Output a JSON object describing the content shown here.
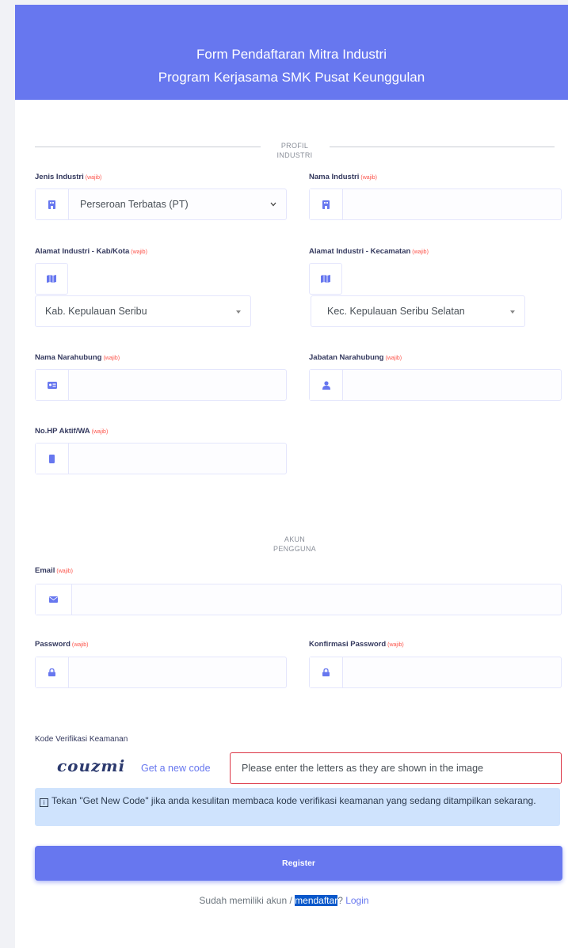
{
  "header": {
    "title_line1": "Form Pendaftaran Mitra Industri",
    "title_line2": "Program Kerjasama SMK Pusat Keunggulan"
  },
  "required_tag": "(wajib)",
  "section_profil": {
    "line1": "PROFIL",
    "line2": "INDUSTRI"
  },
  "section_akun": {
    "line1": "AKUN",
    "line2": "PENGGUNA"
  },
  "fields": {
    "jenis_industri": {
      "label": "Jenis Industri",
      "value": "Perseroan Terbatas (PT)",
      "icon": "building-icon"
    },
    "nama_industri": {
      "label": "Nama Industri",
      "value": "",
      "icon": "building-icon"
    },
    "kabkota": {
      "label": "Alamat Industri - Kab/Kota",
      "value": "Kab. Kepulauan Seribu",
      "icon": "map-icon"
    },
    "kecamatan": {
      "label": "Alamat Industri - Kecamatan",
      "value": "Kec. Kepulauan Seribu Selatan",
      "icon": "map-icon"
    },
    "nama_narahubung": {
      "label": "Nama Narahubung",
      "value": "",
      "icon": "id-card-icon"
    },
    "jabatan_narahubung": {
      "label": "Jabatan Narahubung",
      "value": "",
      "icon": "user-icon"
    },
    "nohp": {
      "label": "No.HP Aktif/WA",
      "value": "",
      "icon": "mobile-icon"
    },
    "email": {
      "label": "Email",
      "value": "",
      "icon": "envelope-icon"
    },
    "password": {
      "label": "Password",
      "value": "",
      "icon": "lock-icon"
    },
    "konfirmasi_password": {
      "label": "Konfirmasi Password",
      "value": "",
      "icon": "lock-icon"
    }
  },
  "captcha": {
    "label": "Kode Verifikasi Keamanan",
    "image_text": "couzmi",
    "refresh_link": "Get a new code",
    "placeholder": "Please enter the letters as they are shown in the image",
    "info": "Tekan \"Get New Code\" jika anda kesulitan membaca kode verifikasi keamanan yang sedang ditampilkan sekarang."
  },
  "register_button": "Register",
  "footer": {
    "prefix": "Sudah memiliki akun / ",
    "highlight": "mendaftar",
    "suffix": "? ",
    "login_link": "Login"
  },
  "colors": {
    "primary": "#6777ef",
    "required": "#fc544b",
    "info_bg": "#cfe3fd",
    "error_border": "#dc3545"
  }
}
